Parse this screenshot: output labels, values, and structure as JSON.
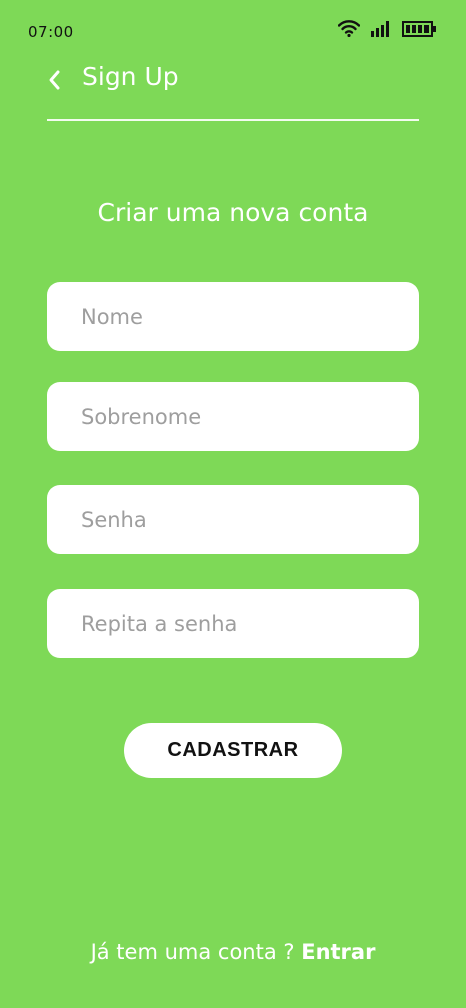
{
  "status_bar": {
    "time": "07:00",
    "icons": [
      "wifi-icon",
      "signal-icon",
      "battery-icon"
    ]
  },
  "header": {
    "back_icon": "chevron-left-icon",
    "title": "Sign Up"
  },
  "heading": "Criar uma nova conta",
  "form": {
    "first_name": {
      "placeholder": "Nome",
      "value": ""
    },
    "last_name": {
      "placeholder": "Sobrenome",
      "value": ""
    },
    "password": {
      "placeholder": "Senha",
      "value": ""
    },
    "repeat_password": {
      "placeholder": "Repita a senha",
      "value": ""
    }
  },
  "register_button": "CADASTRAR",
  "footer": {
    "prompt": "Já tem uma conta ?",
    "login_link": "Entrar"
  },
  "colors": {
    "background": "#7ED957",
    "surface": "#FFFFFF",
    "text_dark": "#111111",
    "placeholder": "#9E9E9E"
  }
}
